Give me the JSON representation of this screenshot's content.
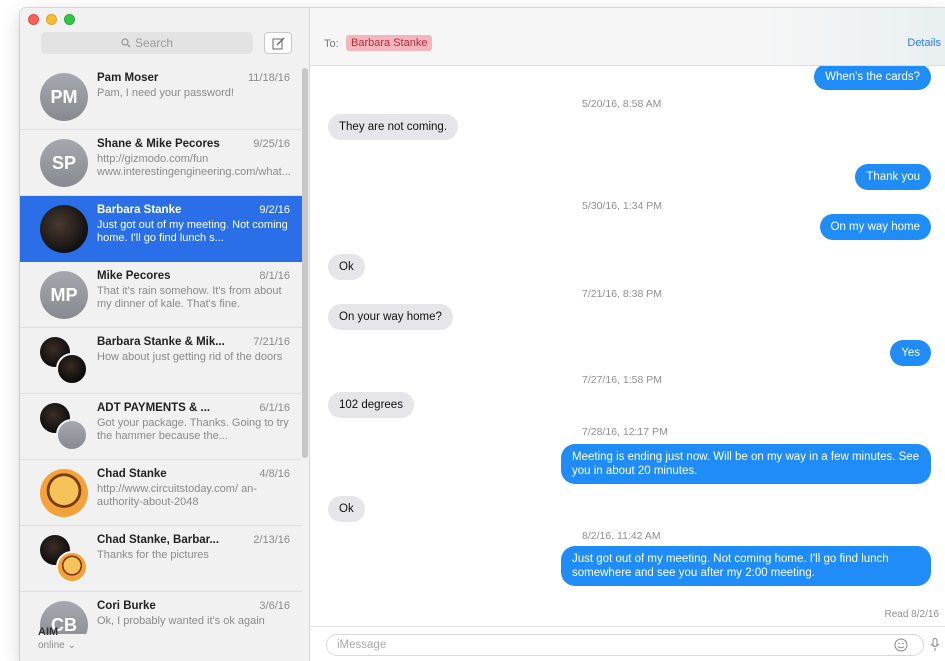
{
  "sidebar": {
    "search_placeholder": "Search",
    "conversations": [
      {
        "name": "Pam Moser",
        "date": "11/18/16",
        "preview": "Pam, I need your password!",
        "initials": "PM",
        "avatar": "initials",
        "selected": false
      },
      {
        "name": "Shane & Mike Pecores",
        "date": "9/25/16",
        "preview": "http://gizmodo.com/fun www.interestingengineering.com/what...",
        "initials": "SP",
        "avatar": "initials",
        "selected": false
      },
      {
        "name": "Barbara Stanke",
        "date": "9/2/16",
        "preview": "Just got out of my meeting. Not coming home. I'll go find lunch s...",
        "initials": "",
        "avatar": "photo",
        "selected": true
      },
      {
        "name": "Mike Pecores",
        "date": "8/1/16",
        "preview": "That it's rain somehow. It's from about my dinner of kale. That's fine.",
        "initials": "MP",
        "avatar": "initials",
        "selected": false
      },
      {
        "name": "Barbara Stanke & Mik...",
        "date": "7/21/16",
        "preview": "How about just getting rid of the doors",
        "initials": "",
        "avatar": "group-gray-dark",
        "selected": false
      },
      {
        "name": "ADT PAYMENTS & ...",
        "date": "6/1/16",
        "preview": "Got your package. Thanks. Going to try the hammer because the...",
        "initials": "",
        "avatar": "group-dark-gray",
        "selected": false
      },
      {
        "name": "Chad Stanke",
        "date": "4/8/16",
        "preview": "http://www.circuitstoday.com/ an-authority-about-2048",
        "initials": "",
        "avatar": "cartoon",
        "selected": false
      },
      {
        "name": "Chad Stanke, Barbar...",
        "date": "2/13/16",
        "preview": "Thanks for the pictures",
        "initials": "",
        "avatar": "group-dark-cartoon",
        "selected": false
      },
      {
        "name": "Cori Burke",
        "date": "3/6/16",
        "preview": "Ok, I probably wanted it's ok again",
        "initials": "CB",
        "avatar": "initials",
        "selected": false
      }
    ],
    "account": {
      "name": "AIM",
      "status": "online"
    }
  },
  "header": {
    "to_label": "To:",
    "recipient": "Barbara Stanke",
    "details_label": "Details"
  },
  "thread": {
    "messages": [
      {
        "kind": "out",
        "text": "When's the cards?"
      },
      {
        "kind": "time",
        "text": "5/20/16, 8:58 AM"
      },
      {
        "kind": "in",
        "text": "They are not coming."
      },
      {
        "kind": "out",
        "text": "Thank you"
      },
      {
        "kind": "time",
        "text": "5/30/16, 1:34 PM"
      },
      {
        "kind": "out",
        "text": "On my way home"
      },
      {
        "kind": "in",
        "text": "Ok"
      },
      {
        "kind": "time",
        "text": "7/21/16, 8:38 PM"
      },
      {
        "kind": "in",
        "text": "On your way home?"
      },
      {
        "kind": "out",
        "text": "Yes"
      },
      {
        "kind": "time",
        "text": "7/27/16, 1:58 PM"
      },
      {
        "kind": "in",
        "text": "102 degrees"
      },
      {
        "kind": "time",
        "text": "7/28/16, 12:17 PM"
      },
      {
        "kind": "out",
        "text": "Meeting is ending just now. Will be on my way in a few minutes. See you in about 20 minutes."
      },
      {
        "kind": "in",
        "text": "Ok"
      },
      {
        "kind": "time",
        "text": "8/2/16, 11:42 AM"
      },
      {
        "kind": "out",
        "text": "Just got out of my meeting. Not coming home. I'll go find lunch somewhere and see you after my 2:00 meeting."
      },
      {
        "kind": "receipt",
        "text": "Read 8/2/16"
      }
    ]
  },
  "composer": {
    "placeholder": "iMessage"
  },
  "colors": {
    "accent": "#2a6ee8",
    "outgoing_bubble": "#1f8cf7",
    "incoming_bubble": "#e5e5ea",
    "recipient_tag": "#f3b6bd"
  },
  "icons": {
    "emoji": "smiley-icon",
    "microphone": "microphone-icon",
    "compose": "compose-icon",
    "search": "search-icon"
  }
}
